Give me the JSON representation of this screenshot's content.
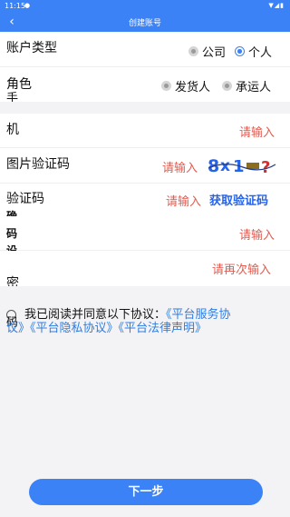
{
  "status": {
    "time": "11:15",
    "notif_glyph": "●",
    "right_glyphs": "▼◢▮"
  },
  "nav": {
    "title": "创建账号",
    "back_icon": "chevron-left-icon",
    "back_glyph": "‹"
  },
  "account_type": {
    "label": "账户类型",
    "options": [
      "公司",
      "个人"
    ],
    "selected": "个人"
  },
  "role": {
    "label_line1": "角色",
    "label_line2": "手",
    "options": [
      "发货人",
      "承运人"
    ],
    "selected": ""
  },
  "phone": {
    "label": "机",
    "placeholder": "请输入"
  },
  "image_captcha": {
    "label": "图片验证码",
    "placeholder": "请输入",
    "captcha_text": "8x1ℸ?"
  },
  "sms_code": {
    "label": "验证码",
    "placeholder": "请输入",
    "button": "获取验证码"
  },
  "password": {
    "label_a": "确",
    "label_b": "码",
    "label_c": "设",
    "placeholder": "请输入"
  },
  "confirm_password": {
    "label_a": "密",
    "label_b": "码",
    "placeholder": "请再次输入"
  },
  "agreement": {
    "prefix": "我已阅读并同意以下协议：",
    "link1": "《平台服务协",
    "link1_cont": "议》",
    "link2": "《平台隐私协议》",
    "link3": "《平台法律声明》"
  },
  "footer": {
    "next_label": "下一步"
  },
  "colors": {
    "accent": "#3b82f6",
    "hint": "#e15b4f",
    "link": "#2f7de1"
  }
}
